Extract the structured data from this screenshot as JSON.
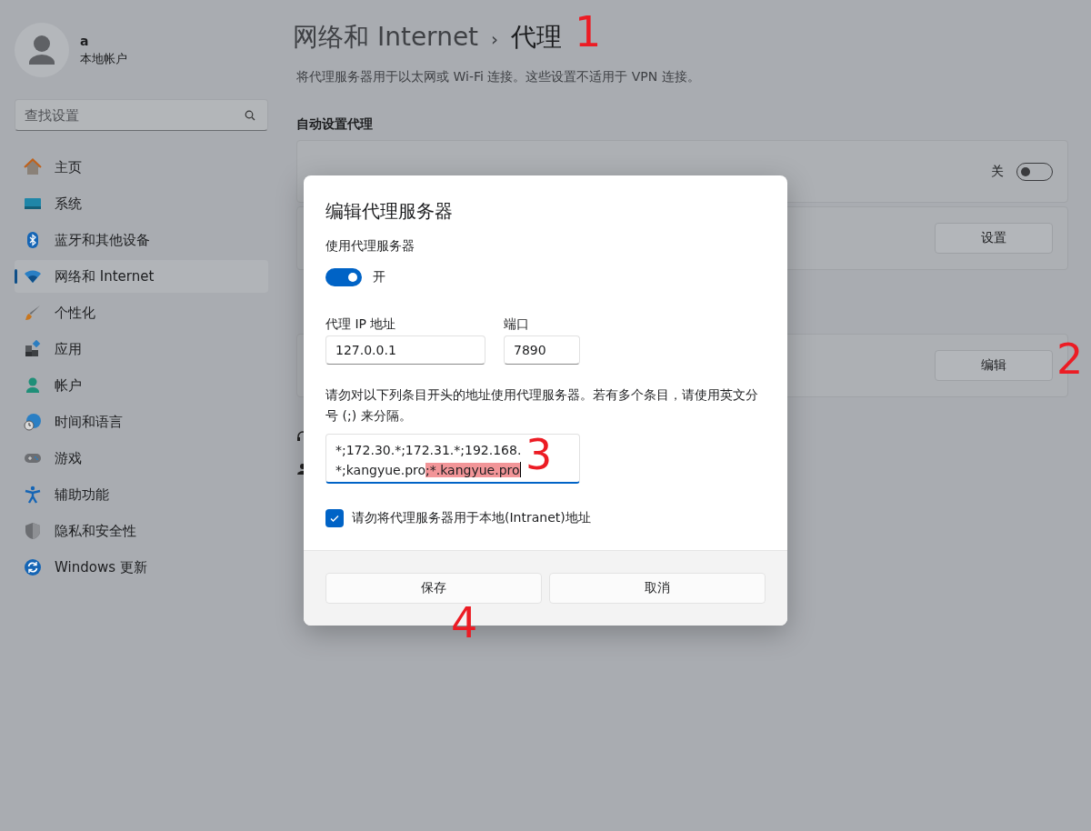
{
  "sidebar": {
    "user": {
      "name": "a",
      "account_type": "本地帐户"
    },
    "search": {
      "placeholder": "查找设置"
    },
    "items": [
      {
        "label": "主页",
        "selected": false
      },
      {
        "label": "系统",
        "selected": false
      },
      {
        "label": "蓝牙和其他设备",
        "selected": false
      },
      {
        "label": "网络和 Internet",
        "selected": true
      },
      {
        "label": "个性化",
        "selected": false
      },
      {
        "label": "应用",
        "selected": false
      },
      {
        "label": "帐户",
        "selected": false
      },
      {
        "label": "时间和语言",
        "selected": false
      },
      {
        "label": "游戏",
        "selected": false
      },
      {
        "label": "辅助功能",
        "selected": false
      },
      {
        "label": "隐私和安全性",
        "selected": false
      },
      {
        "label": "Windows 更新",
        "selected": false
      }
    ]
  },
  "header": {
    "parent": "网络和 Internet",
    "separator": "›",
    "title": "代理"
  },
  "description": "将代理服务器用于以太网或 Wi-Fi 连接。这些设置不适用于 VPN 连接。",
  "auto_section": {
    "heading": "自动设置代理",
    "auto_detect": {
      "state_label": "关",
      "on": false
    },
    "setup_button": "设置"
  },
  "manual_section": {
    "edit_button": "编辑"
  },
  "dialog": {
    "title": "编辑代理服务器",
    "use_proxy": {
      "label": "使用代理服务器",
      "state_label": "开",
      "on": true
    },
    "ip": {
      "label": "代理 IP 地址",
      "value": "127.0.0.1"
    },
    "port": {
      "label": "端口",
      "value": "7890"
    },
    "exceptions": {
      "instructions": "请勿对以下列条目开头的地址使用代理服务器。若有多个条目，请使用英文分号 (;) 来分隔。",
      "lines": [
        "*;172.30.*;172.31.*;192.168.",
        "*;kangyue.pro"
      ],
      "selected_text": ";*.kangyue.pro"
    },
    "bypass_local": {
      "label": "请勿将代理服务器用于本地(Intranet)地址",
      "checked": true
    },
    "buttons": [
      {
        "label": "保存"
      },
      {
        "label": "取消"
      }
    ]
  },
  "annotations": [
    "1",
    "2",
    "3",
    "4"
  ]
}
